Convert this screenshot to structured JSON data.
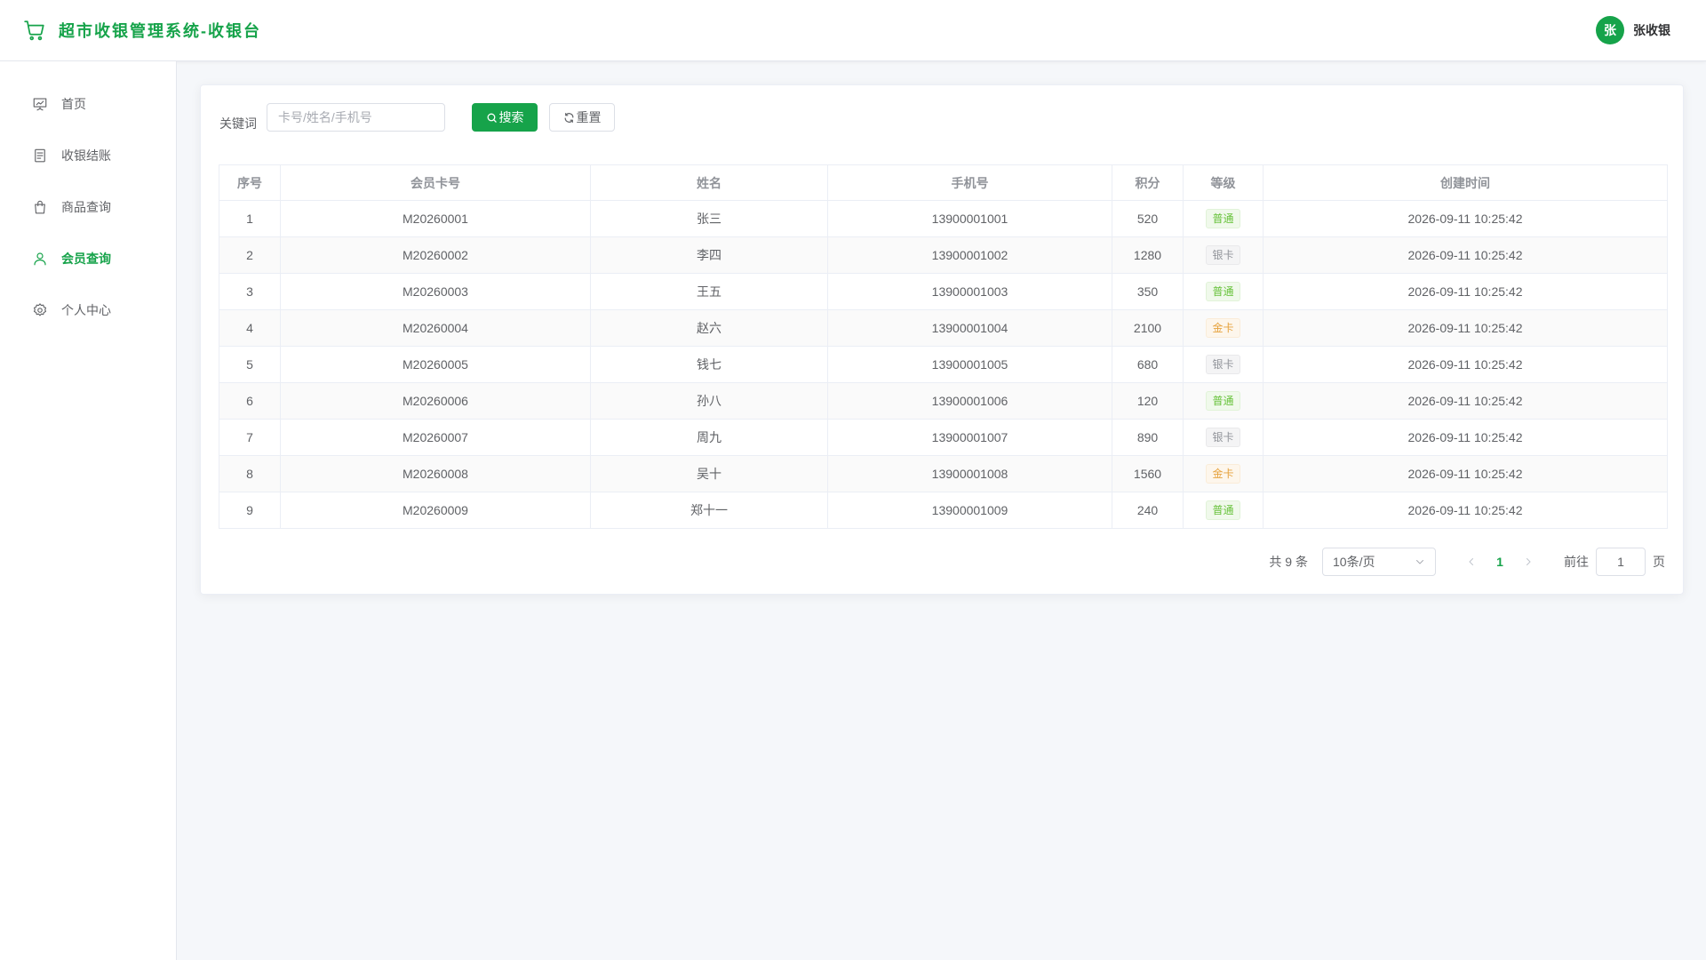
{
  "header": {
    "title": "超市收银管理系统-收银台",
    "user_initial": "张",
    "user_name": "张收银"
  },
  "sidebar": {
    "items": [
      {
        "label": "首页",
        "icon": "home-chart-icon",
        "active": false
      },
      {
        "label": "收银结账",
        "icon": "receipt-icon",
        "active": false
      },
      {
        "label": "商品查询",
        "icon": "shopping-bag-icon",
        "active": false
      },
      {
        "label": "会员查询",
        "icon": "user-icon",
        "active": true
      },
      {
        "label": "个人中心",
        "icon": "gear-icon",
        "active": false
      }
    ]
  },
  "search": {
    "label": "关键词",
    "placeholder": "卡号/姓名/手机号",
    "value": "",
    "search_label": "搜索",
    "reset_label": "重置"
  },
  "table": {
    "columns": [
      "序号",
      "会员卡号",
      "姓名",
      "手机号",
      "积分",
      "等级",
      "创建时间"
    ],
    "rows": [
      {
        "index": "1",
        "card": "M20260001",
        "name": "张三",
        "phone": "13900001001",
        "points": "520",
        "level": "普通",
        "level_type": "green",
        "created": "2026-09-11 10:25:42"
      },
      {
        "index": "2",
        "card": "M20260002",
        "name": "李四",
        "phone": "13900001002",
        "points": "1280",
        "level": "银卡",
        "level_type": "gray",
        "created": "2026-09-11 10:25:42"
      },
      {
        "index": "3",
        "card": "M20260003",
        "name": "王五",
        "phone": "13900001003",
        "points": "350",
        "level": "普通",
        "level_type": "green",
        "created": "2026-09-11 10:25:42"
      },
      {
        "index": "4",
        "card": "M20260004",
        "name": "赵六",
        "phone": "13900001004",
        "points": "2100",
        "level": "金卡",
        "level_type": "gold",
        "created": "2026-09-11 10:25:42"
      },
      {
        "index": "5",
        "card": "M20260005",
        "name": "钱七",
        "phone": "13900001005",
        "points": "680",
        "level": "银卡",
        "level_type": "gray",
        "created": "2026-09-11 10:25:42"
      },
      {
        "index": "6",
        "card": "M20260006",
        "name": "孙八",
        "phone": "13900001006",
        "points": "120",
        "level": "普通",
        "level_type": "green",
        "created": "2026-09-11 10:25:42"
      },
      {
        "index": "7",
        "card": "M20260007",
        "name": "周九",
        "phone": "13900001007",
        "points": "890",
        "level": "银卡",
        "level_type": "gray",
        "created": "2026-09-11 10:25:42"
      },
      {
        "index": "8",
        "card": "M20260008",
        "name": "吴十",
        "phone": "13900001008",
        "points": "1560",
        "level": "金卡",
        "level_type": "gold",
        "created": "2026-09-11 10:25:42"
      },
      {
        "index": "9",
        "card": "M20260009",
        "name": "郑十一",
        "phone": "13900001009",
        "points": "240",
        "level": "普通",
        "level_type": "green",
        "created": "2026-09-11 10:25:42"
      }
    ]
  },
  "pagination": {
    "total_text": "共 9 条",
    "page_size": "10条/页",
    "current_page": "1",
    "goto_label": "前往",
    "goto_value": "1",
    "page_suffix": "页"
  },
  "colors": {
    "brand": "#16a34a",
    "background": "#f5f7fa",
    "tag_green": "#67c23a",
    "tag_gray": "#909399",
    "tag_gold": "#e6a23c"
  }
}
